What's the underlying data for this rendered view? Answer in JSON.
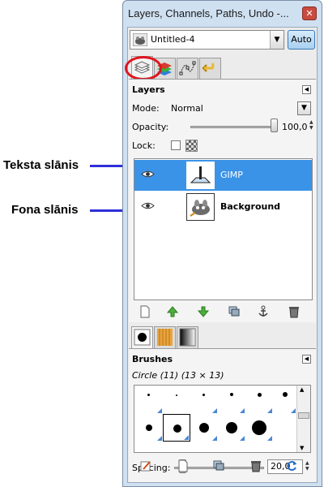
{
  "window": {
    "title": "Layers, Channels, Paths, Undo -..."
  },
  "image_menu": {
    "image_name": "Untitled-4",
    "auto_label": "Auto"
  },
  "dock_tabs": [
    "layers-tab-icon",
    "channels-tab-icon",
    "paths-tab-icon",
    "undo-tab-icon"
  ],
  "layers": {
    "heading": "Layers",
    "mode_label": "Mode:",
    "mode_value": "Normal",
    "opacity_label": "Opacity:",
    "opacity_value": "100,0",
    "opacity": 1.0,
    "lock_label": "Lock:",
    "items": [
      {
        "name": "GIMP",
        "selected": true
      },
      {
        "name": "Background",
        "selected": false
      }
    ]
  },
  "annotations": [
    {
      "label": "Teksta slānis"
    },
    {
      "label": "Fona slānis"
    }
  ],
  "brushes": {
    "heading": "Brushes",
    "current": "Circle (11) (13 × 13)",
    "spacing_label": "Spacing:",
    "spacing_value": "20,0"
  },
  "colors": {
    "selection": "#3b93e8",
    "highlight_ring": "#e0141c",
    "arrow": "#2f2fd8",
    "window_frame": "#cfe0f1"
  }
}
